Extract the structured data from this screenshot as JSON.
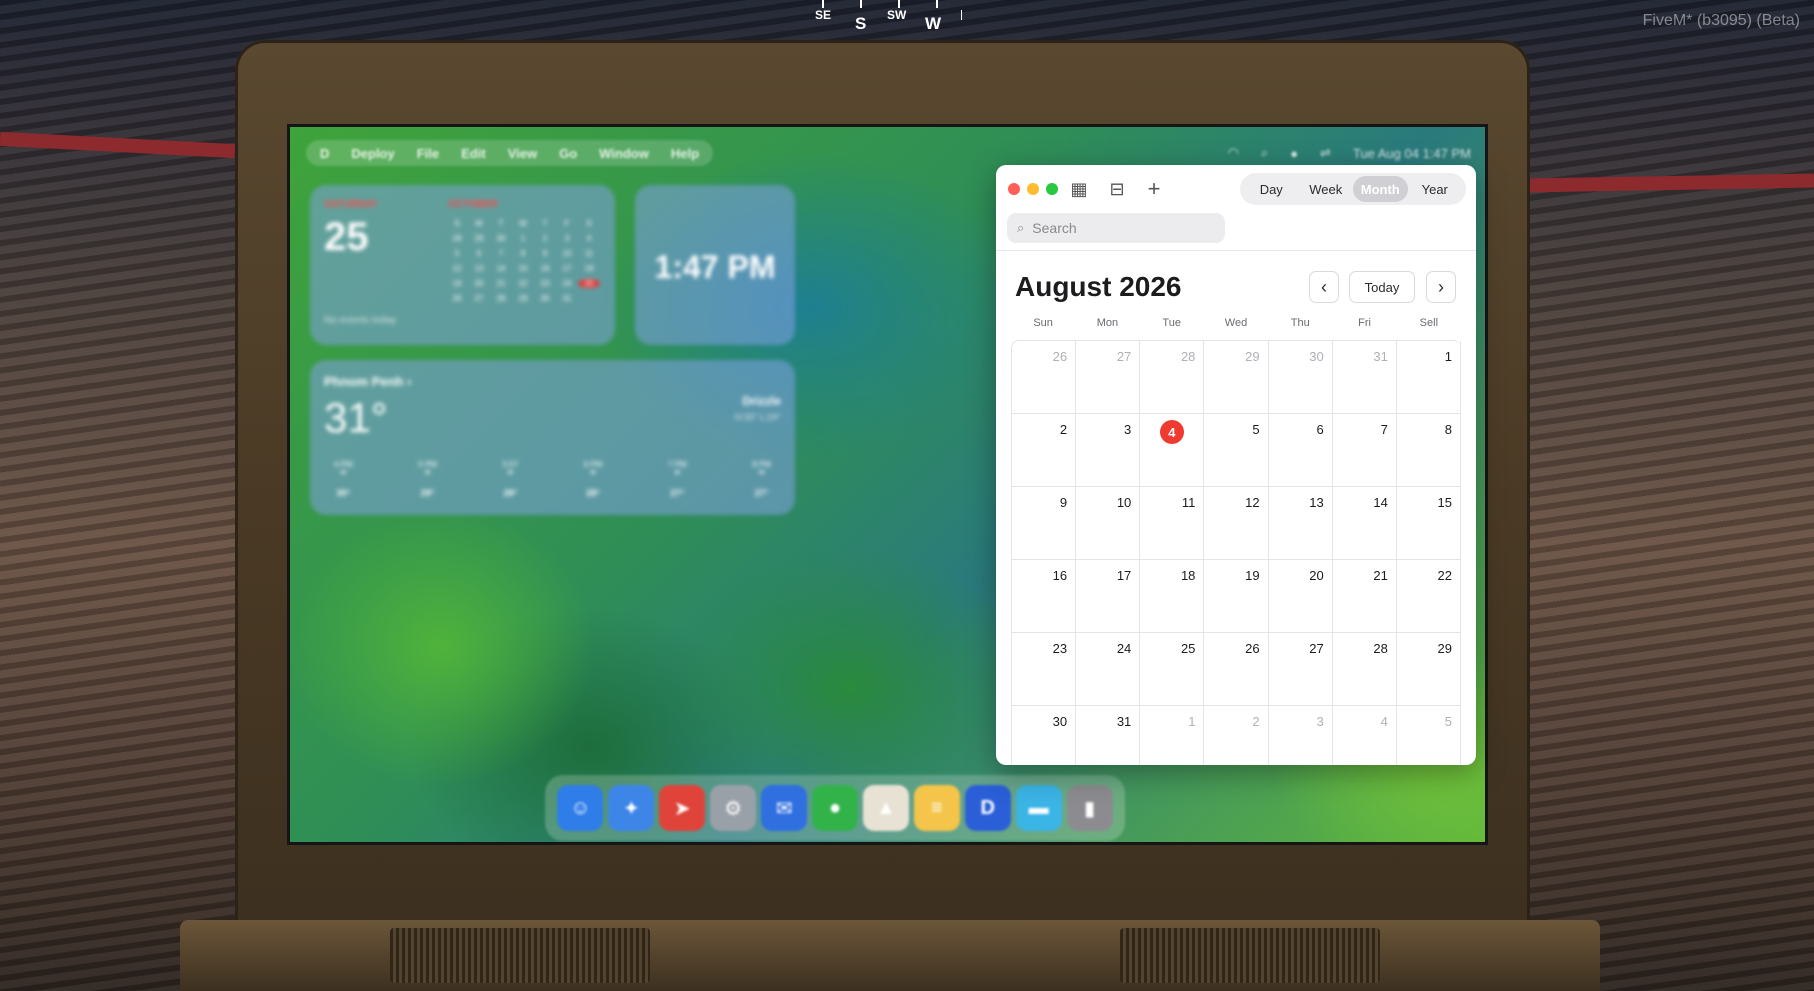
{
  "hud": {
    "compass": [
      "SE",
      "S",
      "SW",
      "W"
    ],
    "watermark": "FiveM* (b3095) (Beta)"
  },
  "menubar": {
    "logo": "D",
    "items": [
      "Deploy",
      "File",
      "Edit",
      "View",
      "Go",
      "Window",
      "Help"
    ],
    "clock": "Tue Aug 04 1:47 PM"
  },
  "widgets": {
    "calendar": {
      "day_name": "SATURDAY",
      "day_number": "25",
      "note": "No events today",
      "month_name": "OCTOBER",
      "days": [
        "S",
        "M",
        "T",
        "W",
        "T",
        "F",
        "S",
        "28",
        "29",
        "30",
        "1",
        "2",
        "3",
        "4",
        "5",
        "6",
        "7",
        "8",
        "9",
        "10",
        "11",
        "12",
        "13",
        "14",
        "15",
        "16",
        "17",
        "18",
        "19",
        "20",
        "21",
        "22",
        "23",
        "24",
        "25",
        "26",
        "27",
        "28",
        "29",
        "30",
        "31",
        ""
      ],
      "today_index": 34
    },
    "clock": {
      "time": "1:47 PM"
    },
    "weather": {
      "city": "Phnom Penh ›",
      "temp": "31°",
      "condition": "Drizzle",
      "high_low": "H:33° L:24°",
      "hours": [
        {
          "time": "4 PM",
          "temp": "30°"
        },
        {
          "time": "5 PM",
          "temp": "29°"
        },
        {
          "time": "5:57",
          "temp": "28°"
        },
        {
          "time": "6 PM",
          "temp": "28°"
        },
        {
          "time": "7 PM",
          "temp": "27°"
        },
        {
          "time": "8 PM",
          "temp": "27°"
        }
      ]
    }
  },
  "dock": {
    "apps": [
      {
        "name": "finder",
        "color": "#2f7de8",
        "glyph": "☺"
      },
      {
        "name": "safari",
        "color": "#3d86e8",
        "glyph": "✦"
      },
      {
        "name": "rocket",
        "color": "#e0433a",
        "glyph": "➤"
      },
      {
        "name": "settings",
        "color": "#9aa0a8",
        "glyph": "⚙"
      },
      {
        "name": "mail",
        "color": "#2f6fe0",
        "glyph": "✉"
      },
      {
        "name": "messages",
        "color": "#32b34a",
        "glyph": "●"
      },
      {
        "name": "maps",
        "color": "#e8e2d4",
        "glyph": "▲"
      },
      {
        "name": "notes",
        "color": "#f4c54a",
        "glyph": "≡"
      },
      {
        "name": "deploy",
        "color": "#2b5fd8",
        "glyph": "D"
      },
      {
        "name": "folder",
        "color": "#3bb4e6",
        "glyph": "▬"
      },
      {
        "name": "trash",
        "color": "#8c8c90",
        "glyph": "▮"
      }
    ]
  },
  "calendar_app": {
    "views": [
      "Day",
      "Week",
      "Month",
      "Year"
    ],
    "active_view": "Month",
    "search_placeholder": "Search",
    "month_title": "August 2026",
    "today_button": "Today",
    "prev": "‹",
    "next": "›",
    "weekdays": [
      "Sun",
      "Mon",
      "Tue",
      "Wed",
      "Thu",
      "Fri",
      "Sell"
    ],
    "days": [
      {
        "n": "26",
        "dim": true
      },
      {
        "n": "27",
        "dim": true
      },
      {
        "n": "28",
        "dim": true
      },
      {
        "n": "29",
        "dim": true
      },
      {
        "n": "30",
        "dim": true
      },
      {
        "n": "31",
        "dim": true
      },
      {
        "n": "1"
      },
      {
        "n": "2"
      },
      {
        "n": "3"
      },
      {
        "n": "4",
        "today": true
      },
      {
        "n": "5"
      },
      {
        "n": "6"
      },
      {
        "n": "7"
      },
      {
        "n": "8"
      },
      {
        "n": "9"
      },
      {
        "n": "10"
      },
      {
        "n": "11"
      },
      {
        "n": "12"
      },
      {
        "n": "13"
      },
      {
        "n": "14"
      },
      {
        "n": "15"
      },
      {
        "n": "16"
      },
      {
        "n": "17"
      },
      {
        "n": "18"
      },
      {
        "n": "19"
      },
      {
        "n": "20"
      },
      {
        "n": "21"
      },
      {
        "n": "22"
      },
      {
        "n": "23"
      },
      {
        "n": "24"
      },
      {
        "n": "25"
      },
      {
        "n": "26"
      },
      {
        "n": "27"
      },
      {
        "n": "28"
      },
      {
        "n": "29"
      },
      {
        "n": "30"
      },
      {
        "n": "31"
      },
      {
        "n": "1",
        "dim": true
      },
      {
        "n": "2",
        "dim": true
      },
      {
        "n": "3",
        "dim": true
      },
      {
        "n": "4",
        "dim": true
      },
      {
        "n": "5",
        "dim": true
      }
    ],
    "colors": {
      "today": "#f03a2f",
      "close": "#ff5f57",
      "minimize": "#febc2e",
      "zoom": "#28c840"
    }
  }
}
